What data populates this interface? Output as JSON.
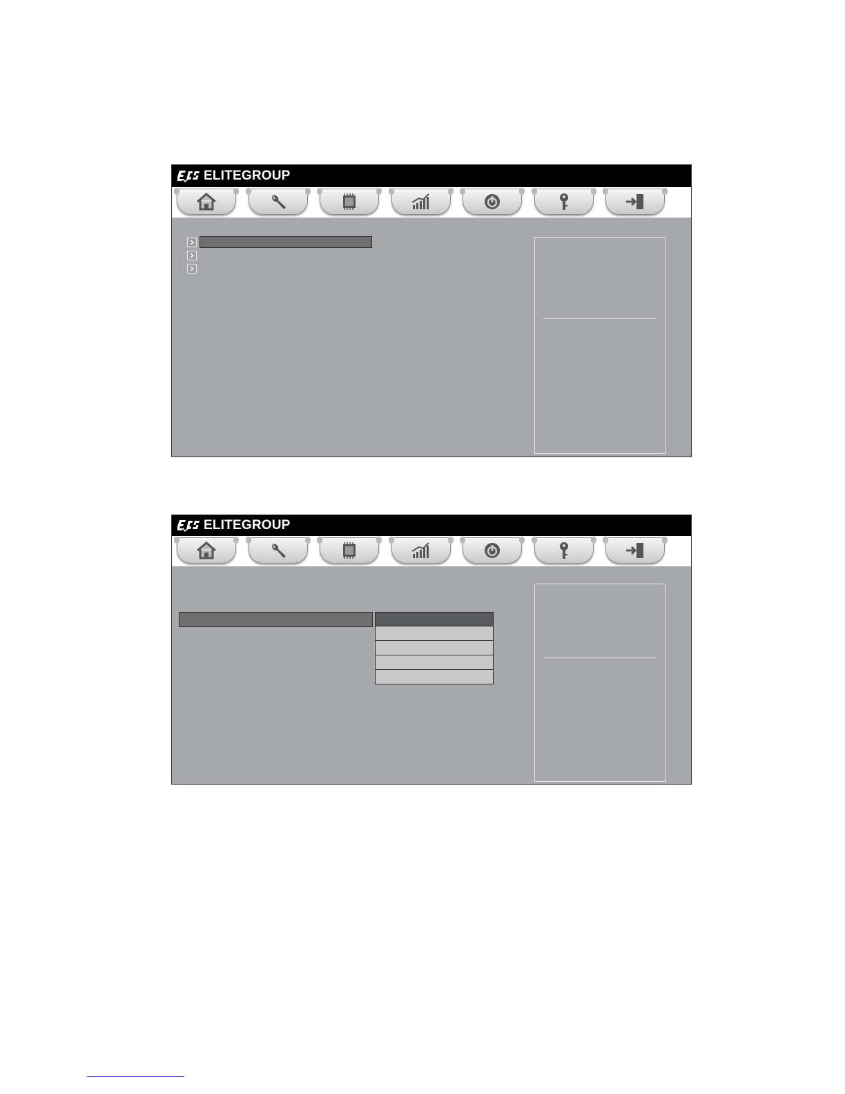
{
  "brand": {
    "name": "ELITEGROUP",
    "logo_icon": "ecs-logo-icon"
  },
  "tabs": [
    {
      "icon": "home-icon"
    },
    {
      "icon": "wrench-icon"
    },
    {
      "icon": "chip-icon"
    },
    {
      "icon": "performance-chart-icon"
    },
    {
      "icon": "power-icon"
    },
    {
      "icon": "key-icon"
    },
    {
      "icon": "exit-door-icon"
    }
  ],
  "screen1": {
    "menu_items": [
      {
        "label": "",
        "icon": "chevron-right-icon",
        "selected": true
      },
      {
        "label": "",
        "icon": "chevron-right-icon",
        "selected": false
      },
      {
        "label": "",
        "icon": "chevron-right-icon",
        "selected": false
      }
    ],
    "help_text": ""
  },
  "screen2": {
    "setting_label": "",
    "dropdown_options": [
      "",
      "",
      "",
      "",
      ""
    ],
    "help_text": ""
  },
  "colors": {
    "title_bar": "#000000",
    "content_bg": "#a7a8ab",
    "highlight": "#6f6f70",
    "dropdown_selected": "#58595b",
    "dropdown_option": "#c8c8c9"
  }
}
